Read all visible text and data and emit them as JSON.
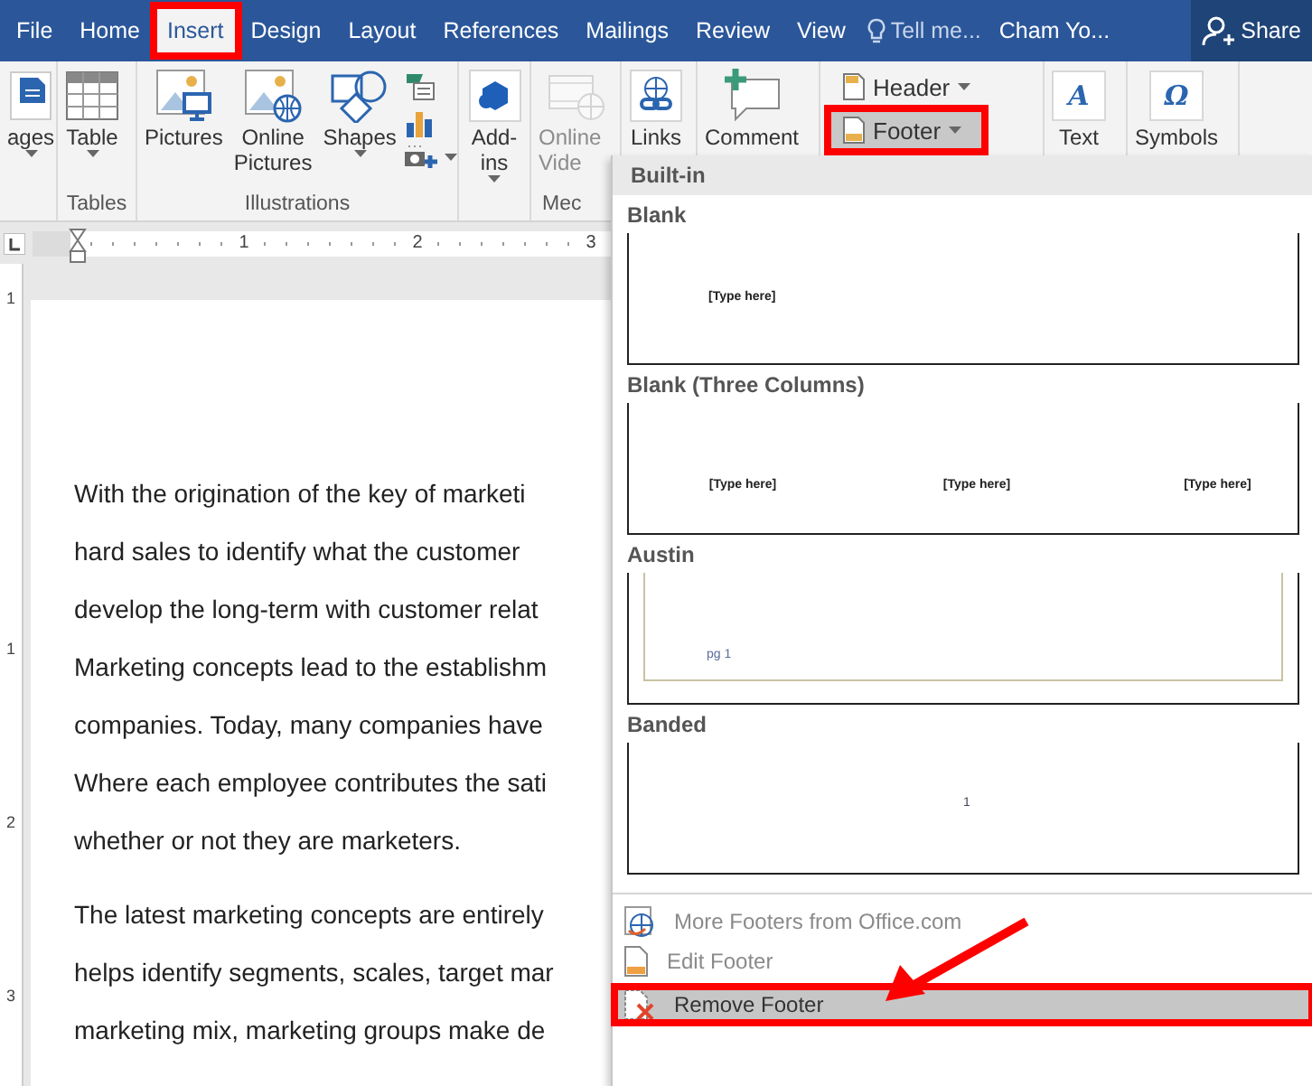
{
  "tabs": [
    {
      "label": "File",
      "selected": false,
      "highlighted": false
    },
    {
      "label": "Home",
      "selected": false,
      "highlighted": false
    },
    {
      "label": "Insert",
      "selected": true,
      "highlighted": true
    },
    {
      "label": "Design",
      "selected": false,
      "highlighted": false
    },
    {
      "label": "Layout",
      "selected": false,
      "highlighted": false
    },
    {
      "label": "References",
      "selected": false,
      "highlighted": false
    },
    {
      "label": "Mailings",
      "selected": false,
      "highlighted": false
    },
    {
      "label": "Review",
      "selected": false,
      "highlighted": false
    },
    {
      "label": "View",
      "selected": false,
      "highlighted": false
    }
  ],
  "tell_me": {
    "placeholder": "Tell me..."
  },
  "user": "Cham Yo...",
  "share": "Share",
  "ribbon": {
    "groups": [
      {
        "buttons": [
          {
            "kind": "pages",
            "label": "ages",
            "dropdown": true
          }
        ]
      },
      {
        "label": "Tables",
        "buttons": [
          {
            "kind": "table",
            "label": "Table",
            "dropdown": true
          }
        ]
      },
      {
        "label": "Illustrations",
        "buttons": [
          {
            "kind": "pictures",
            "label": "Pictures"
          },
          {
            "kind": "online_pictures",
            "label": "Online Pictures"
          },
          {
            "kind": "shapes",
            "label": "Shapes",
            "dropdown": true
          },
          {
            "kind": "stack",
            "dropdown": true
          }
        ]
      },
      {
        "buttons": [
          {
            "kind": "addins",
            "label": "Add-ins",
            "dropdown": true
          }
        ]
      },
      {
        "label": "Mec",
        "buttons": [
          {
            "kind": "video",
            "label": "Online Vide",
            "disabled": true
          }
        ]
      },
      {
        "buttons": [
          {
            "kind": "links",
            "label": "Links"
          }
        ]
      },
      {
        "buttons": [
          {
            "kind": "comment",
            "label": "Comment"
          }
        ]
      },
      {
        "buttons": [
          {
            "kind": "small_header",
            "label": "Header",
            "dropdown": true,
            "highlighted": false
          },
          {
            "kind": "small_footer",
            "label": "Footer",
            "dropdown": true,
            "highlighted": true
          }
        ]
      },
      {
        "buttons": [
          {
            "kind": "glyph",
            "glyph": "A",
            "label": "Text"
          }
        ]
      },
      {
        "buttons": [
          {
            "kind": "glyph",
            "glyph": "Ω",
            "label": "Symbols"
          }
        ]
      }
    ]
  },
  "ruler": {
    "numbers": [
      "1",
      "2",
      "3"
    ],
    "vertical_numbers": [
      "1",
      "1",
      "2",
      "3"
    ]
  },
  "document": {
    "paragraphs": [
      [
        "With the origination of the key of marketi",
        "hard sales to identify what the customer",
        "develop the long-term with customer relat",
        "Marketing concepts lead to the establishm",
        "companies. Today, many companies have",
        "Where each employee contributes the sati",
        "whether or not they are marketers."
      ],
      [
        "The latest marketing concepts are entirely",
        "helps identify segments, scales, target mar",
        "marketing mix, marketing groups make de"
      ]
    ]
  },
  "footer_menu": {
    "header": "Built-in",
    "gallery": [
      {
        "name": "Blank",
        "kind": "single",
        "texts": [
          "[Type here]"
        ]
      },
      {
        "name": "Blank (Three Columns)",
        "kind": "three",
        "texts": [
          "[Type here]",
          "[Type here]",
          "[Type here]"
        ]
      },
      {
        "name": "Austin",
        "kind": "framed",
        "texts": [
          "pg 1"
        ]
      },
      {
        "name": "Banded",
        "kind": "centered",
        "texts": [
          "1"
        ]
      }
    ],
    "items": [
      {
        "kind": "more",
        "label": "More Footers from Office.com",
        "highlighted": false,
        "disabled": true
      },
      {
        "kind": "edit",
        "label": "Edit Footer",
        "highlighted": false,
        "disabled": true
      },
      {
        "kind": "remove",
        "label": "Remove Footer",
        "highlighted": true,
        "disabled": false
      }
    ]
  }
}
